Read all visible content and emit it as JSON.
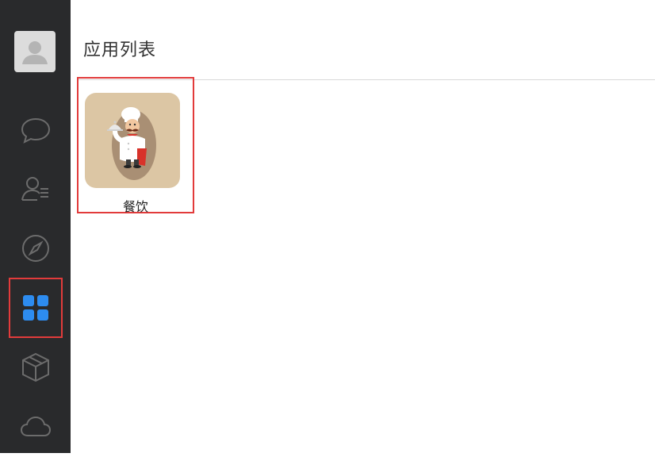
{
  "page": {
    "title": "应用列表"
  },
  "sidebar": {
    "items": [
      {
        "id": "messages",
        "icon": "chat-bubble-icon",
        "active": false
      },
      {
        "id": "contacts",
        "icon": "contacts-icon",
        "active": false
      },
      {
        "id": "discover",
        "icon": "compass-icon",
        "active": false
      },
      {
        "id": "apps",
        "icon": "apps-grid-icon",
        "active": true
      },
      {
        "id": "packages",
        "icon": "cube-icon",
        "active": false
      },
      {
        "id": "cloud",
        "icon": "cloud-icon",
        "active": false
      }
    ],
    "accent_color": "#2d8cf0",
    "icon_color": "#6c6c6c",
    "background": "#292a2c"
  },
  "apps": [
    {
      "label": "餐饮",
      "icon": "chef-icon",
      "selected": true
    }
  ],
  "colors": {
    "selection_border": "#e23b3b",
    "tile_background": "#dcc6a4"
  }
}
